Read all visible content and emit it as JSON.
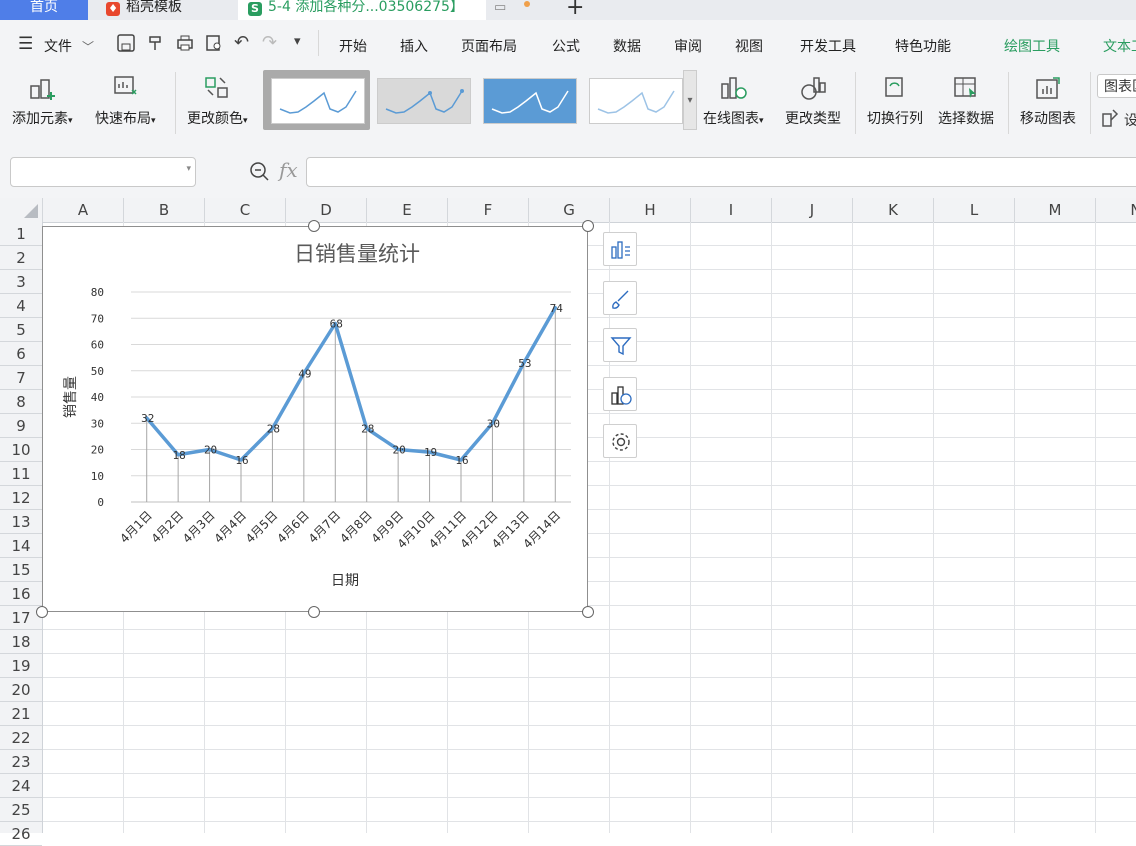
{
  "tabs": [
    {
      "label": "首页"
    },
    {
      "label": "稻壳模板"
    },
    {
      "label": "5-4 添加各种分...03506275】"
    }
  ],
  "menu": {
    "file_label": "文件",
    "items": [
      "开始",
      "插入",
      "页面布局",
      "公式",
      "数据",
      "审阅",
      "视图",
      "开发工具",
      "特色功能",
      "绘图工具",
      "文本工"
    ]
  },
  "ribbon": {
    "add_element": "添加元素",
    "quick_layout": "快速布局",
    "change_color": "更改颜色",
    "online_chart": "在线图表",
    "change_type": "更改类型",
    "switch_rowcol": "切换行列",
    "select_data": "选择数据",
    "move_chart": "移动图表",
    "chart_area": "图表区",
    "settings_partial": "设"
  },
  "formula_bar": {
    "fx": "fx",
    "name_value": "",
    "formula_value": ""
  },
  "sheet": {
    "columns": [
      "A",
      "B",
      "C",
      "D",
      "E",
      "F",
      "G",
      "H",
      "I",
      "J",
      "K",
      "L",
      "M",
      "N"
    ],
    "rows": [
      "1",
      "2",
      "3",
      "4",
      "5",
      "6",
      "7",
      "8",
      "9",
      "10",
      "11",
      "12",
      "13",
      "14",
      "15",
      "16",
      "17",
      "18",
      "19",
      "20",
      "21",
      "22",
      "23",
      "24",
      "25",
      "26"
    ]
  },
  "chart_data": {
    "type": "line",
    "title": "日销售量统计",
    "xlabel": "日期",
    "ylabel": "销售量",
    "categories": [
      "4月1日",
      "4月2日",
      "4月3日",
      "4月4日",
      "4月5日",
      "4月6日",
      "4月7日",
      "4月8日",
      "4月9日",
      "4月10日",
      "4月11日",
      "4月12日",
      "4月13日",
      "4月14日"
    ],
    "values": [
      32,
      18,
      20,
      16,
      28,
      49,
      68,
      28,
      20,
      19,
      16,
      30,
      53,
      74
    ],
    "ylim": [
      0,
      80
    ],
    "yticks": [
      "0",
      "10",
      "20",
      "30",
      "40",
      "50",
      "60",
      "70",
      "80"
    ],
    "grid": true,
    "drop_lines": true,
    "data_labels": true,
    "line_color": "#5b9bd5"
  },
  "colors": {
    "accent": "#4f7ee8",
    "green": "#2a9d60",
    "line": "#5b9bd5"
  }
}
